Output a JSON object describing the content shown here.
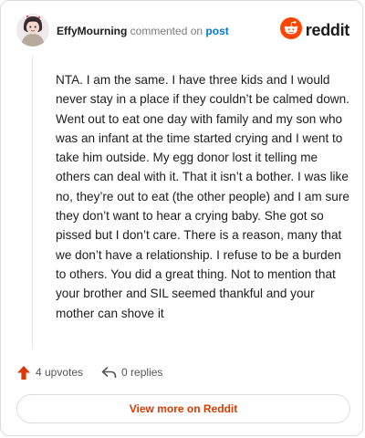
{
  "header": {
    "author": "EffyMourning",
    "action_text": "commented on",
    "target_text": "post",
    "brand": "reddit"
  },
  "comment": {
    "text": "NTA. I am the same. I have three kids and I would never stay in a place if they couldn’t be calmed down. Went out to eat one day with family and my son who was an infant at the time started crying and I went to take him outside. My egg donor lost it telling me others can deal with it. That it isn’t a bother. I was like no, they’re out to eat (the other people) and I am sure they don’t want to hear a crying baby. She got so pissed but I don’t care. There is a reason, many that we don’t have a relationship. I refuse to be a burden to others. You did a great thing. Not to mention that your brother and SIL seemed thankful and your mother can shove it"
  },
  "actions": {
    "upvotes": "4 upvotes",
    "replies": "0 replies"
  },
  "footer": {
    "view_more": "View more on Reddit"
  },
  "colors": {
    "brand": "#ff4500",
    "link": "#0079d3",
    "view_more": "#d93a00"
  },
  "icons": [
    "avatar",
    "reddit-logo-icon",
    "upvote-arrow-icon",
    "reply-arrow-icon"
  ]
}
